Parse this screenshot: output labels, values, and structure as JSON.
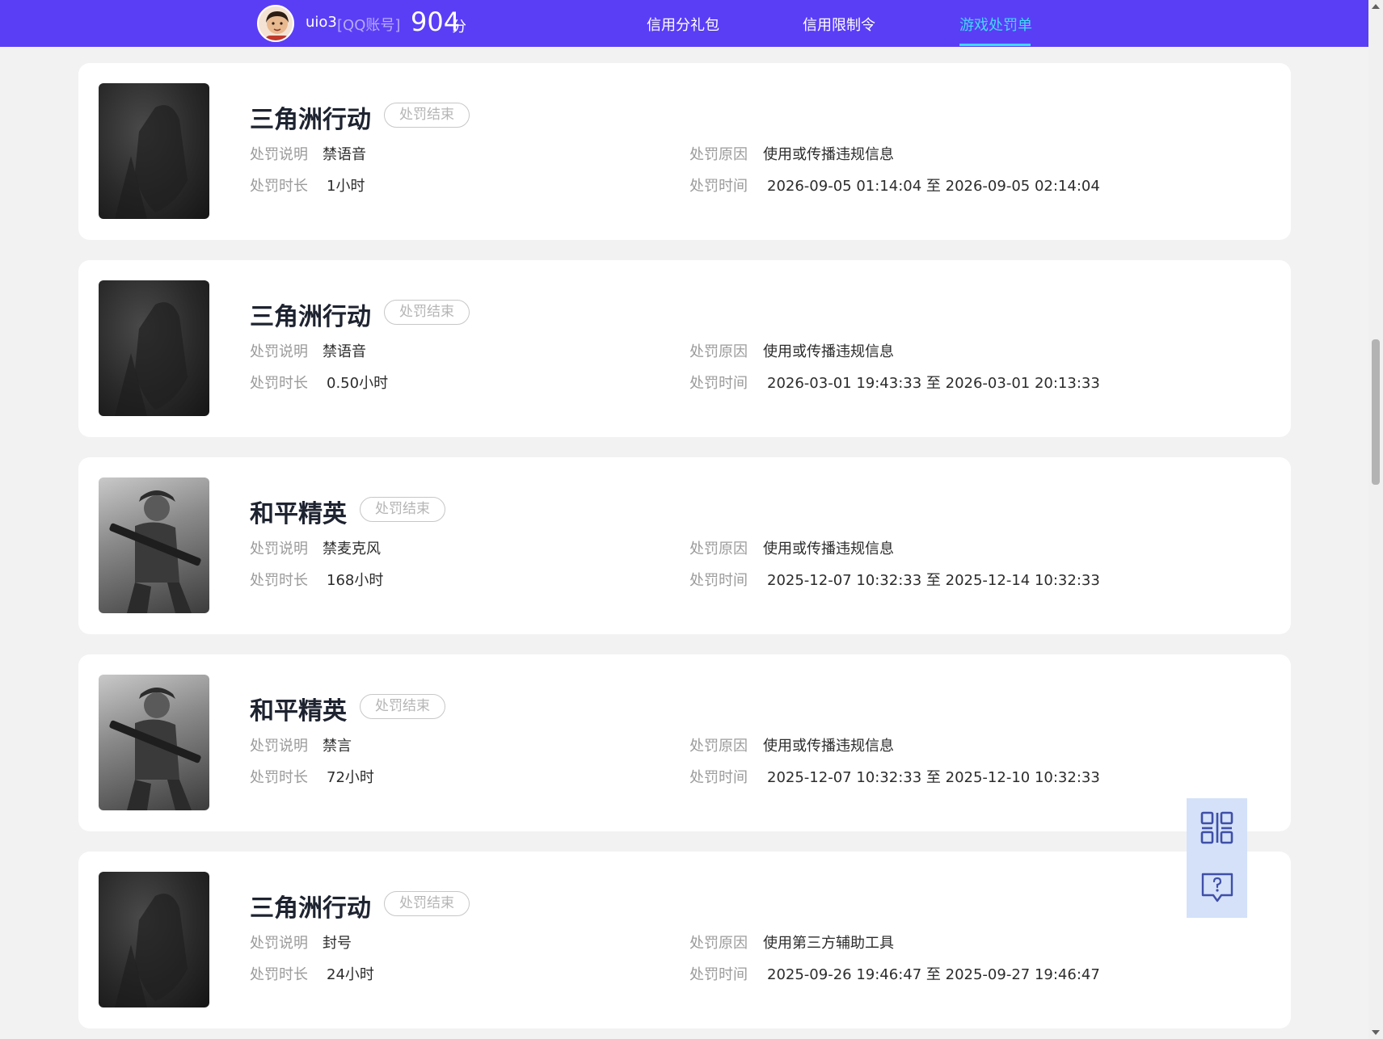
{
  "header": {
    "username": "uio3",
    "account_type": "[QQ账号]",
    "score": "904",
    "score_unit": "分",
    "nav": [
      "信用分礼包",
      "信用限制令",
      "游戏处罚单"
    ],
    "active_nav": "游戏处罚单",
    "accent": "#5a3ef6",
    "active_color": "#41d9f5"
  },
  "labels": {
    "desc": "处罚说明",
    "duration": "处罚时长",
    "reason": "处罚原因",
    "time": "处罚时间"
  },
  "records": [
    {
      "game": "三角洲行动",
      "status": "处罚结束",
      "desc": "禁语音",
      "duration": "1小时",
      "reason": "使用或传播违规信息",
      "time": "2026-09-05 01:14:04 至 2026-09-05 02:14:04"
    },
    {
      "game": "三角洲行动",
      "status": "处罚结束",
      "desc": "禁语音",
      "duration": "0.50小时",
      "reason": "使用或传播违规信息",
      "time": "2026-03-01 19:43:33 至 2026-03-01 20:13:33"
    },
    {
      "game": "和平精英",
      "status": "处罚结束",
      "desc": "禁麦克风",
      "duration": "168小时",
      "reason": "使用或传播违规信息",
      "time": "2025-12-07 10:32:33 至 2025-12-14 10:32:33"
    },
    {
      "game": "和平精英",
      "status": "处罚结束",
      "desc": "禁言",
      "duration": "72小时",
      "reason": "使用或传播违规信息",
      "time": "2025-12-07 10:32:33 至 2025-12-10 10:32:33"
    },
    {
      "game": "三角洲行动",
      "status": "处罚结束",
      "desc": "封号",
      "duration": "24小时",
      "reason": "使用第三方辅助工具",
      "time": "2025-09-26 19:46:47 至 2025-09-27 19:46:47"
    }
  ],
  "side_buttons": [
    "qr-code-icon",
    "help-feedback-icon"
  ]
}
